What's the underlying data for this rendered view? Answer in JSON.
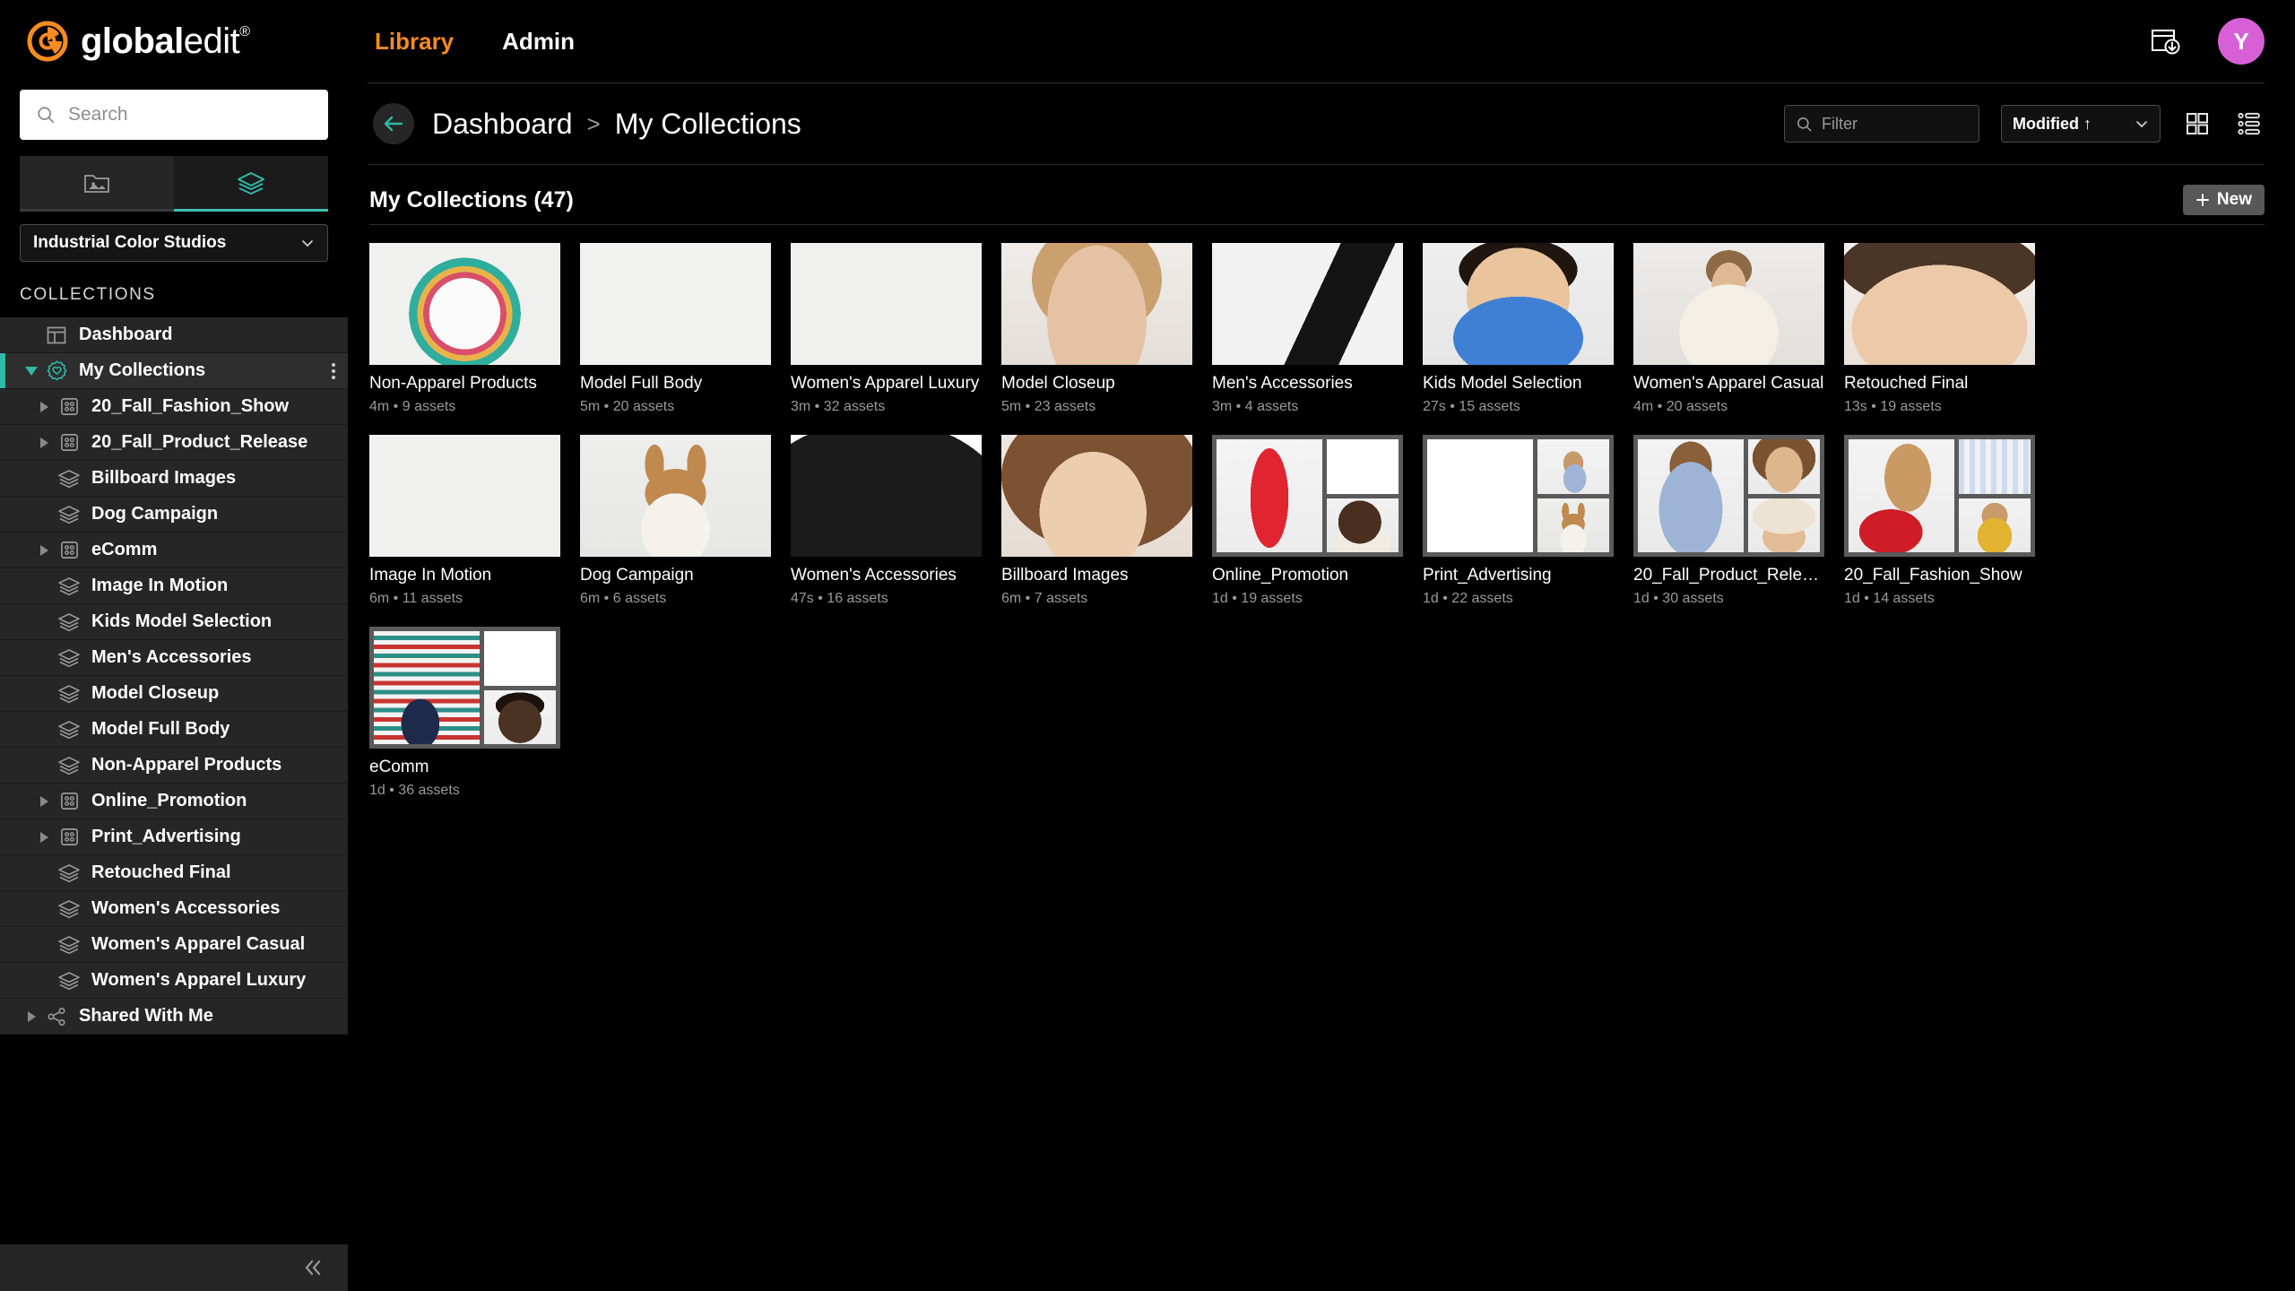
{
  "brand": {
    "name_bold": "global",
    "name_light": "edit",
    "registered": "®",
    "logo_color": "#F68B1F"
  },
  "search": {
    "placeholder": "Search",
    "icon": "search-icon"
  },
  "panel_tabs": [
    {
      "name": "assets-tab",
      "icon": "folder-image-icon",
      "active": false
    },
    {
      "name": "collections-tab",
      "icon": "layers-icon",
      "active": true
    }
  ],
  "org_select": {
    "value": "Industrial Color Studios",
    "icon": "chevron-down-icon"
  },
  "sidebar": {
    "section_label": "COLLECTIONS",
    "items": [
      {
        "label": "Dashboard",
        "icon": "dashboard-icon",
        "depth": 0,
        "twisty": "none",
        "selected": false
      },
      {
        "label": "My Collections",
        "icon": "favorite-badge-icon",
        "depth": 0,
        "twisty": "open",
        "selected": true,
        "kebab": true
      },
      {
        "label": "20_Fall_Fashion_Show",
        "icon": "album-grid-icon",
        "depth": 1,
        "twisty": "closed",
        "selected": false
      },
      {
        "label": "20_Fall_Product_Release",
        "icon": "album-grid-icon",
        "depth": 1,
        "twisty": "closed",
        "selected": false
      },
      {
        "label": "Billboard Images",
        "icon": "layers-icon",
        "depth": 1,
        "twisty": "none",
        "selected": false
      },
      {
        "label": "Dog Campaign",
        "icon": "layers-icon",
        "depth": 1,
        "twisty": "none",
        "selected": false
      },
      {
        "label": "eComm",
        "icon": "album-grid-icon",
        "depth": 1,
        "twisty": "closed",
        "selected": false
      },
      {
        "label": "Image In Motion",
        "icon": "layers-icon",
        "depth": 1,
        "twisty": "none",
        "selected": false
      },
      {
        "label": "Kids Model Selection",
        "icon": "layers-icon",
        "depth": 1,
        "twisty": "none",
        "selected": false
      },
      {
        "label": "Men's Accessories",
        "icon": "layers-icon",
        "depth": 1,
        "twisty": "none",
        "selected": false
      },
      {
        "label": "Model Closeup",
        "icon": "layers-icon",
        "depth": 1,
        "twisty": "none",
        "selected": false
      },
      {
        "label": "Model Full Body",
        "icon": "layers-icon",
        "depth": 1,
        "twisty": "none",
        "selected": false
      },
      {
        "label": "Non-Apparel Products",
        "icon": "layers-icon",
        "depth": 1,
        "twisty": "none",
        "selected": false
      },
      {
        "label": "Online_Promotion",
        "icon": "album-grid-icon",
        "depth": 1,
        "twisty": "closed",
        "selected": false
      },
      {
        "label": "Print_Advertising",
        "icon": "album-grid-icon",
        "depth": 1,
        "twisty": "closed",
        "selected": false
      },
      {
        "label": "Retouched Final",
        "icon": "layers-icon",
        "depth": 1,
        "twisty": "none",
        "selected": false
      },
      {
        "label": "Women's Accessories",
        "icon": "layers-icon",
        "depth": 1,
        "twisty": "none",
        "selected": false
      },
      {
        "label": "Women's Apparel Casual",
        "icon": "layers-icon",
        "depth": 1,
        "twisty": "none",
        "selected": false
      },
      {
        "label": "Women's Apparel Luxury",
        "icon": "layers-icon",
        "depth": 1,
        "twisty": "none",
        "selected": false
      },
      {
        "label": "Shared With Me",
        "icon": "share-network-icon",
        "depth": 0,
        "twisty": "closed",
        "selected": false
      }
    ],
    "collapse_icon": "chevron-double-left-icon"
  },
  "topnav": {
    "items": [
      {
        "label": "Library",
        "active": true
      },
      {
        "label": "Admin",
        "active": false
      }
    ],
    "active_color": "#F68B1F",
    "downloads_icon": "downloads-inbox-icon",
    "avatar": {
      "initial": "Y",
      "color": "#D760D7"
    }
  },
  "breadcrumb": {
    "back_icon": "arrow-left-icon",
    "parent": "Dashboard",
    "separator": ">",
    "current": "My Collections"
  },
  "toolbar": {
    "filter_placeholder": "Filter",
    "filter_icon": "search-icon",
    "sort_value": "Modified ↑",
    "sort_icon": "chevron-down-icon",
    "grid_view_icon": "grid-view-icon",
    "list_view_icon": "list-view-icon"
  },
  "section": {
    "title": "My Collections (47)",
    "new_label": "New",
    "new_icon": "plus-icon"
  },
  "collections": [
    {
      "title": "Non-Apparel Products",
      "age": "4m",
      "assets": "9 assets",
      "layout": "single",
      "bg": "#f0f0ee",
      "art": "plate"
    },
    {
      "title": "Model Full Body",
      "age": "5m",
      "assets": "20 assets",
      "layout": "single",
      "bg": "#f1f1ef",
      "art": "model-yellow"
    },
    {
      "title": "Women's Apparel Luxury",
      "age": "3m",
      "assets": "32 assets",
      "layout": "single",
      "bg": "#efefed",
      "art": "model-red-scarf"
    },
    {
      "title": "Model Closeup",
      "age": "5m",
      "assets": "23 assets",
      "layout": "single",
      "bg": "#efece9",
      "art": "face-blonde"
    },
    {
      "title": "Men's Accessories",
      "age": "3m",
      "assets": "4 assets",
      "layout": "single",
      "bg": "#f2f2f2",
      "art": "sneaker"
    },
    {
      "title": "Kids Model Selection",
      "age": "27s",
      "assets": "15 assets",
      "layout": "single",
      "bg": "#eeeeee",
      "art": "kid"
    },
    {
      "title": "Women's Apparel Casual",
      "age": "4m",
      "assets": "20 assets",
      "layout": "single",
      "bg": "#ecebe8",
      "art": "sweater"
    },
    {
      "title": "Retouched Final",
      "age": "13s",
      "assets": "19 assets",
      "layout": "single",
      "bg": "#f3efec",
      "art": "face-closeup"
    },
    {
      "title": "Image In Motion",
      "age": "6m",
      "assets": "11 assets",
      "layout": "single",
      "bg": "#f0f0ee",
      "art": "red-dress"
    },
    {
      "title": "Dog Campaign",
      "age": "6m",
      "assets": "6 assets",
      "layout": "single",
      "bg": "#eeeeec",
      "art": "dog"
    },
    {
      "title": "Women's Accessories",
      "age": "47s",
      "assets": "16 assets",
      "layout": "single",
      "bg": "#ffffff",
      "art": "black-bag"
    },
    {
      "title": "Billboard Images",
      "age": "6m",
      "assets": "7 assets",
      "layout": "single",
      "bg": "#efe7e1",
      "art": "face-hair"
    },
    {
      "title": "Online_Promotion",
      "age": "1d",
      "assets": "19 assets",
      "layout": "mosaic",
      "art": [
        "red-silk",
        "camera-face",
        "smile-face"
      ]
    },
    {
      "title": "Print_Advertising",
      "age": "1d",
      "assets": "22 assets",
      "layout": "mosaic",
      "art": [
        "yellow-coat",
        "blue-girl",
        "dog"
      ]
    },
    {
      "title": "20_Fall_Product_Release",
      "age": "1d",
      "assets": "30 assets",
      "layout": "mosaic",
      "art": [
        "blue-shirt",
        "brown-hair",
        "knit-face"
      ]
    },
    {
      "title": "20_Fall_Fashion_Show",
      "age": "1d",
      "assets": "14 assets",
      "layout": "mosaic",
      "art": [
        "dog-heels",
        "blue-stripe",
        "yellow-girl"
      ]
    },
    {
      "title": "eComm",
      "age": "1d",
      "assets": "36 assets",
      "layout": "mosaic",
      "art": [
        "socks",
        "red-coat",
        "dark-face"
      ]
    }
  ]
}
